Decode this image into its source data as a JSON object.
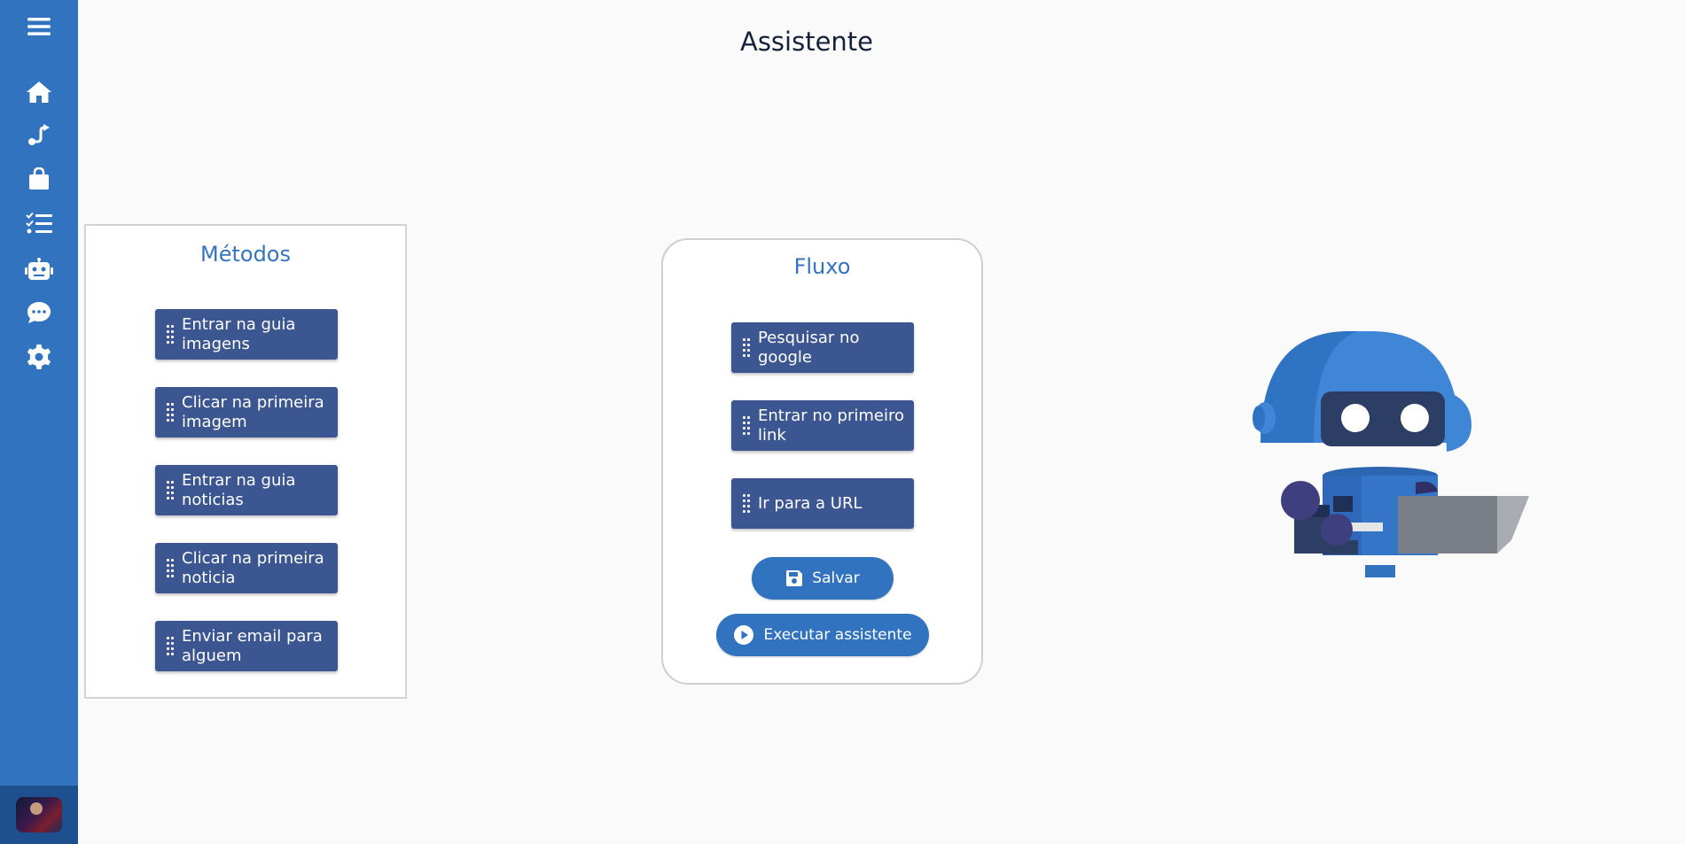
{
  "page": {
    "title": "Assistente"
  },
  "sidebar": {
    "items": [
      {
        "icon": "menu-icon"
      },
      {
        "icon": "home-icon"
      },
      {
        "icon": "route-icon"
      },
      {
        "icon": "shopping-bag-icon"
      },
      {
        "icon": "task-list-icon"
      },
      {
        "icon": "robot-icon"
      },
      {
        "icon": "chat-icon"
      },
      {
        "icon": "gear-icon"
      }
    ]
  },
  "metodos": {
    "title": "Métodos",
    "items": [
      "Entrar na guia imagens",
      "Clicar na primeira imagem",
      "Entrar na guia noticias",
      "Clicar na primeira noticia",
      "Enviar email para alguem"
    ]
  },
  "fluxo": {
    "title": "Fluxo",
    "items": [
      "Pesquisar no google",
      "Entrar no primeiro link",
      "Ir para a URL"
    ],
    "save_label": "Salvar",
    "run_label": "Executar assistente"
  },
  "colors": {
    "sidebar": "#3273c0",
    "accent": "#3574c1",
    "card": "#3b5690"
  }
}
